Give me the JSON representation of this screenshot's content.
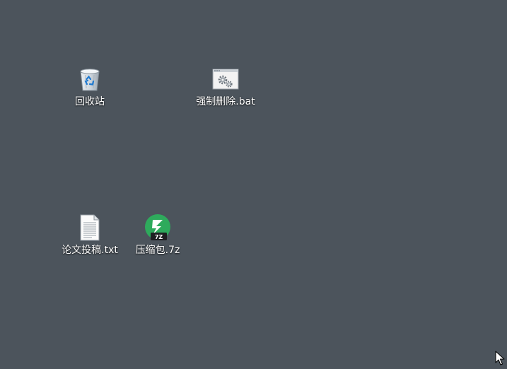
{
  "desktop": {
    "background_color": "#4c545c",
    "icons": [
      {
        "label": "回收站",
        "icon": "recycle-bin-icon"
      },
      {
        "label": "强制删除.bat",
        "icon": "batch-file-gears-icon"
      },
      {
        "label": "论文投稿.txt",
        "icon": "text-document-icon"
      },
      {
        "label": "压缩包.7z",
        "icon": "7z-archive-icon",
        "badge": "7Z",
        "accent_color": "#2eaa5c"
      }
    ]
  },
  "cursor": {
    "icon": "mouse-pointer-icon"
  }
}
